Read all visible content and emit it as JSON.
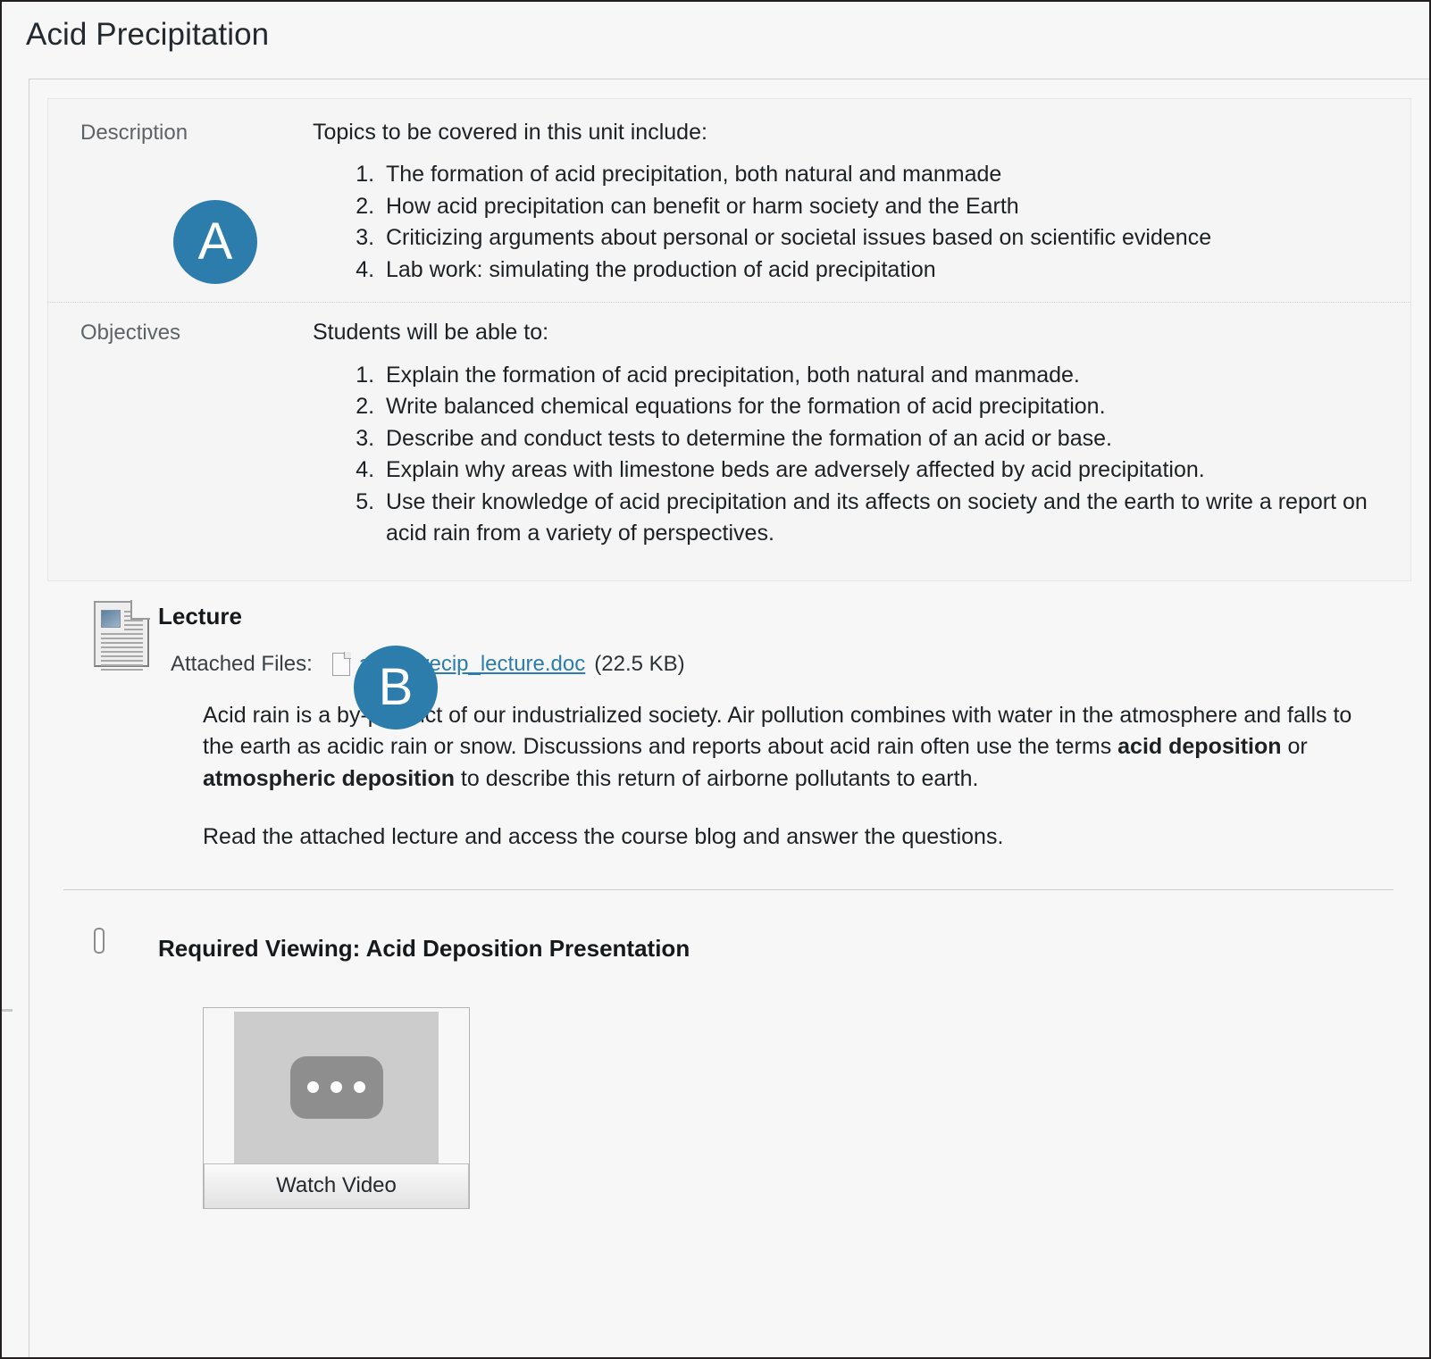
{
  "page": {
    "title": "Acid Precipitation"
  },
  "badges": {
    "a": "A",
    "b": "B"
  },
  "meta": {
    "description": {
      "label": "Description",
      "intro": "Topics to be covered in this unit include:",
      "items": [
        "The formation of acid precipitation, both natural and manmade",
        "How acid precipitation can benefit or harm society and the Earth",
        "Criticizing arguments about personal or societal issues based on scientific evidence",
        "Lab work: simulating the production of acid precipitation"
      ]
    },
    "objectives": {
      "label": "Objectives",
      "intro": "Students will be able to:",
      "items": [
        "Explain the formation of acid precipitation, both natural and manmade.",
        "Write balanced chemical equations for the formation of acid precipitation.",
        "Describe and conduct tests to determine the formation of an acid or base.",
        "Explain why areas with limestone beds are adversely affected by acid precipitation.",
        "Use their knowledge of acid precipitation and its affects on society and the earth to write a report on acid rain from a variety of perspectives."
      ]
    }
  },
  "lecture": {
    "title": "Lecture",
    "attached_label": "Attached Files:",
    "file_name": "acid_precip_lecture.doc",
    "file_size": "(22.5 KB)",
    "paragraph_1_part_1": "Acid rain is a by-product of our industrialized society. Air pollution combines with water in the atmosphere and falls to the earth as acidic rain or snow. Discussions and reports about acid rain often use the terms ",
    "paragraph_1_bold_1": "acid deposition",
    "paragraph_1_part_2": " or ",
    "paragraph_1_bold_2": "atmospheric deposition",
    "paragraph_1_part_3": " to describe this return of airborne pollutants to earth.",
    "paragraph_2": "Read the attached lecture and access the course blog and answer the questions."
  },
  "viewing": {
    "title": "Required Viewing: Acid Deposition Presentation",
    "watch_label": "Watch Video"
  },
  "colors": {
    "badge_blue": "#2c7cac",
    "link_blue": "#2c7cac",
    "page_background": "#f7f7f7",
    "panel_background": "#f5f5f5"
  }
}
